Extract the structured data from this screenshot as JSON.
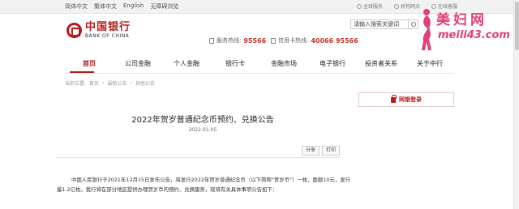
{
  "topbar": {
    "links": [
      "简体中文",
      "繁体中文",
      "English",
      "无障碍浏览"
    ],
    "right_links": [
      "全球服务",
      "机构网点",
      "在线客服"
    ]
  },
  "logo": {
    "cn": "中国银行",
    "en": "BANK OF CHINA"
  },
  "hotlines": {
    "service_label": "服务热线:",
    "service_number": "95566",
    "card_label": "信用卡热线:",
    "card_number": "40066 95566"
  },
  "search": {
    "value": "请输入搜索关键词"
  },
  "watermark": {
    "text1": "美妇网",
    "text2": "meili43.com"
  },
  "nav": [
    "首页",
    "公司金融",
    "个人金融",
    "银行卡",
    "金融市场",
    "电子银行",
    "投资者关系",
    "关于中行"
  ],
  "breadcrumb": [
    "当前位置:",
    "首页",
    "最新公告",
    "其他公告"
  ],
  "login_label": "网银登录",
  "article": {
    "title": "2022年贺岁普通纪念币预约、兑换公告",
    "date": "2022-01-05",
    "share": "分享",
    "print": "打印",
    "paragraph": "中国人民银行于2021年12月15日发布公告，将发行2022年贺岁普通纪念币（以下简称\"贺岁币\"）一枚，面额10元，发行量1.2亿枚。我行将在部分地区提供办理贺岁币的预约、兑换服务，现将有关具体事项公告如下："
  },
  "colors": {
    "brand": "#b71c1c",
    "watermark": "#e0407a"
  }
}
